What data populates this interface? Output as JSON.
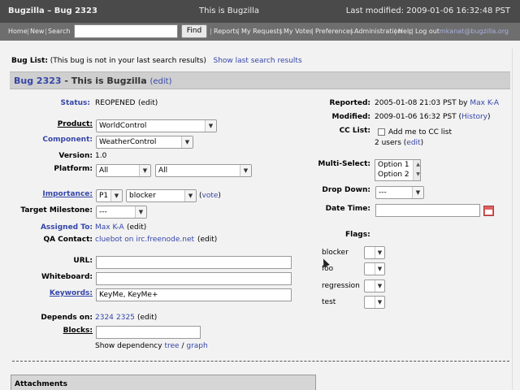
{
  "window": {
    "title": "Bugzilla – Bug 2323",
    "subtitle": "This is Bugzilla",
    "last_modified": "Last modified: 2009-01-06 16:32:48 PST"
  },
  "nav": {
    "home": "Home",
    "new": "New",
    "search": "Search",
    "search_value": "",
    "find_label": "Find",
    "reports": "Reports",
    "my_requests": "My Requests",
    "my_votes": "My Votes",
    "preferences": "Preferences",
    "administration": "Administration",
    "help": "Help",
    "logout": "Log out",
    "user_email": "mkanat@bugzilla.org",
    "sep": "|"
  },
  "buglist": {
    "label": "Bug List:",
    "note": "(This bug is not in your last search results)",
    "link": "Show last search results"
  },
  "bug": {
    "id_link": "Bug 2323",
    "title": " - This is Bugzilla",
    "edit": "(edit)"
  },
  "labels": {
    "status": "Status:",
    "product": "Product:",
    "component": "Component:",
    "version": "Version:",
    "platform": "Platform:",
    "importance": "Importance:",
    "target_milestone": "Target Milestone:",
    "assigned_to": "Assigned To:",
    "qa_contact": "QA Contact:",
    "url": "URL:",
    "whiteboard": "Whiteboard:",
    "keywords": "Keywords:",
    "depends_on": "Depends on:",
    "blocks": "Blocks:",
    "reported": "Reported:",
    "modified": "Modified:",
    "cc_list": "CC List:",
    "multi_select": "Multi-Select:",
    "drop_down": "Drop Down:",
    "date_time": "Date Time:",
    "flags": "Flags:"
  },
  "values": {
    "status": "REOPENED",
    "status_edit": "(edit)",
    "product": "WorldControl",
    "component": "WeatherControl",
    "version": "1.0",
    "platform_hw": "All",
    "platform_os": "All",
    "priority": "P1",
    "severity": "blocker",
    "vote": "vote",
    "target_milestone": "---",
    "assigned_to": "Max K-A",
    "assigned_edit": "(edit)",
    "qa_contact": "cluebot on irc.freenode.net",
    "qa_edit": "(edit)",
    "url": "",
    "whiteboard": "",
    "keywords": "KeyMe, KeyMe+",
    "depends_1": "2324",
    "depends_2": "2325",
    "depends_edit": "(edit)",
    "blocks": "",
    "show_dependency": "Show dependency",
    "tree": "tree",
    "slash": "/",
    "graph": "graph",
    "reported": "2005-01-08 21:03 PST by",
    "reported_by": "Max K-A",
    "modified": "2009-01-06 16:32 PST",
    "history": "History",
    "cc_add": "Add me to CC list",
    "cc_users": "2 users",
    "cc_edit": "edit",
    "multi_options": [
      "Option 1",
      "Option 2"
    ],
    "drop_down": "---",
    "date_time": ""
  },
  "flags": [
    "blocker",
    "foo",
    "regression",
    "test"
  ],
  "attachments": {
    "title": "Attachments"
  }
}
